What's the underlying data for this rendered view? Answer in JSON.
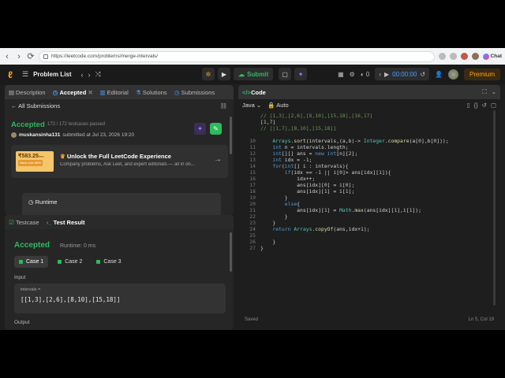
{
  "browser": {
    "url": "https://leetcode.com/problems/merge-intervals/",
    "copilot_label": "Chat"
  },
  "header": {
    "problem_list": "Problem List",
    "submit": "Submit",
    "timer": "00:00:00",
    "streak": "0",
    "premium": "Premium"
  },
  "left_tabs": {
    "description": "Description",
    "accepted": "Accepted",
    "editorial": "Editorial",
    "solutions": "Solutions",
    "submissions": "Submissions"
  },
  "submission": {
    "all_submissions": "All Submissions",
    "status": "Accepted",
    "passed": "172 / 172 testcases passed",
    "user": "muskansinha131",
    "submitted_at": "submitted at Jul 23, 2026 19:20",
    "promo_price": "₹583.25",
    "promo_unit": "/mo",
    "promo_save": "Save over 86%",
    "promo_title": "Unlock the Full LeetCode Experience",
    "promo_sub": "Company problems, Ask Leet, and expert editorials — all in on...",
    "runtime_label": "Runtime"
  },
  "bottom_tabs": {
    "testcase": "Testcase",
    "result": "Test Result"
  },
  "result": {
    "status": "Accepted",
    "runtime": "Runtime: 0 ms",
    "cases": [
      "Case 1",
      "Case 2",
      "Case 3"
    ],
    "input_label": "Input",
    "var_name": "intervals =",
    "var_value": "[[1,3],[2,6],[8,10],[15,18]]",
    "output_label": "Output"
  },
  "code_panel": {
    "title": "Code",
    "language": "Java",
    "auto": "Auto",
    "saved": "Saved",
    "cursor": "Ln 5, Col 19"
  },
  "code_lines": [
    {
      "n": "",
      "t": "// [1,3],[2,6],[8,10],[15,18],[16,17]"
    },
    {
      "n": "",
      "t": "[1,7]"
    },
    {
      "n": "",
      "t": "// [[1,7],[8,10],[15,18]]"
    },
    {
      "n": "",
      "t": ""
    },
    {
      "n": "10",
      "t": "    Arrays.sort(intervals,(a,b)-> Integer.compare(a[0],b[0]));"
    },
    {
      "n": "11",
      "t": "    int n = intervals.length;"
    },
    {
      "n": "12",
      "t": "    int[][] ans = new int[n][2];"
    },
    {
      "n": "13",
      "t": "    int idx = -1;"
    },
    {
      "n": "14",
      "t": "    for(int[] i : intervals){"
    },
    {
      "n": "15",
      "t": "        if(idx == -1 || i[0]> ans[idx][1]){"
    },
    {
      "n": "16",
      "t": "            idx++;"
    },
    {
      "n": "17",
      "t": "            ans[idx][0] = i[0];"
    },
    {
      "n": "18",
      "t": "            ans[idx][1] = i[1];"
    },
    {
      "n": "19",
      "t": "        }"
    },
    {
      "n": "20",
      "t": "        else{"
    },
    {
      "n": "21",
      "t": "            ans[idx][1] = Math.max(ans[idx][1],i[1]);"
    },
    {
      "n": "22",
      "t": "        }"
    },
    {
      "n": "23",
      "t": "    }"
    },
    {
      "n": "24",
      "t": "    return Arrays.copyOf(ans,idx+1);"
    },
    {
      "n": "25",
      "t": ""
    },
    {
      "n": "26",
      "t": "    }"
    },
    {
      "n": "27",
      "t": "}"
    }
  ],
  "colors": {
    "accent": "#ffa116",
    "success": "#2cbb5d",
    "link": "#4a9eff"
  }
}
